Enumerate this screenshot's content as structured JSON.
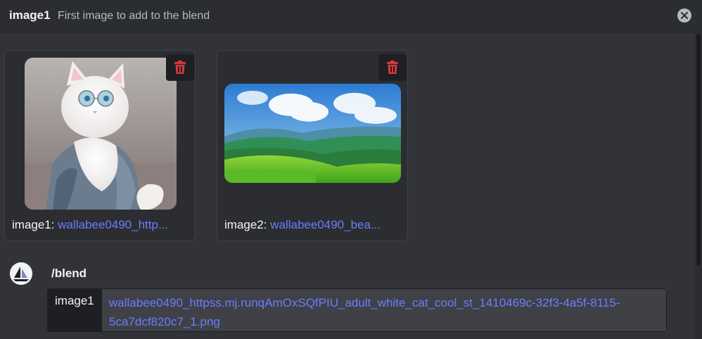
{
  "header": {
    "title": "image1",
    "subtitle": "First image to add to the blend",
    "close_icon": "close-circle-icon"
  },
  "attachments": [
    {
      "label": "image1:",
      "link_text": "wallabee0490_http...",
      "image_desc": "white-cat-with-glasses"
    },
    {
      "label": "image2:",
      "link_text": "wallabee0490_bea...",
      "image_desc": "green-valley-landscape"
    }
  ],
  "command": {
    "name": "/blend",
    "option_name": "image1",
    "option_value": "wallabee0490_httpss.mj.runqAmOxSQfPIU_adult_white_cat_cool_st_1410469c-32f3-4a5f-8115-5ca7dcf820c7_1.png"
  },
  "colors": {
    "background": "#313338",
    "header_bg": "#2b2d31",
    "link": "#6a7dfc",
    "trash_red": "#da373c"
  }
}
